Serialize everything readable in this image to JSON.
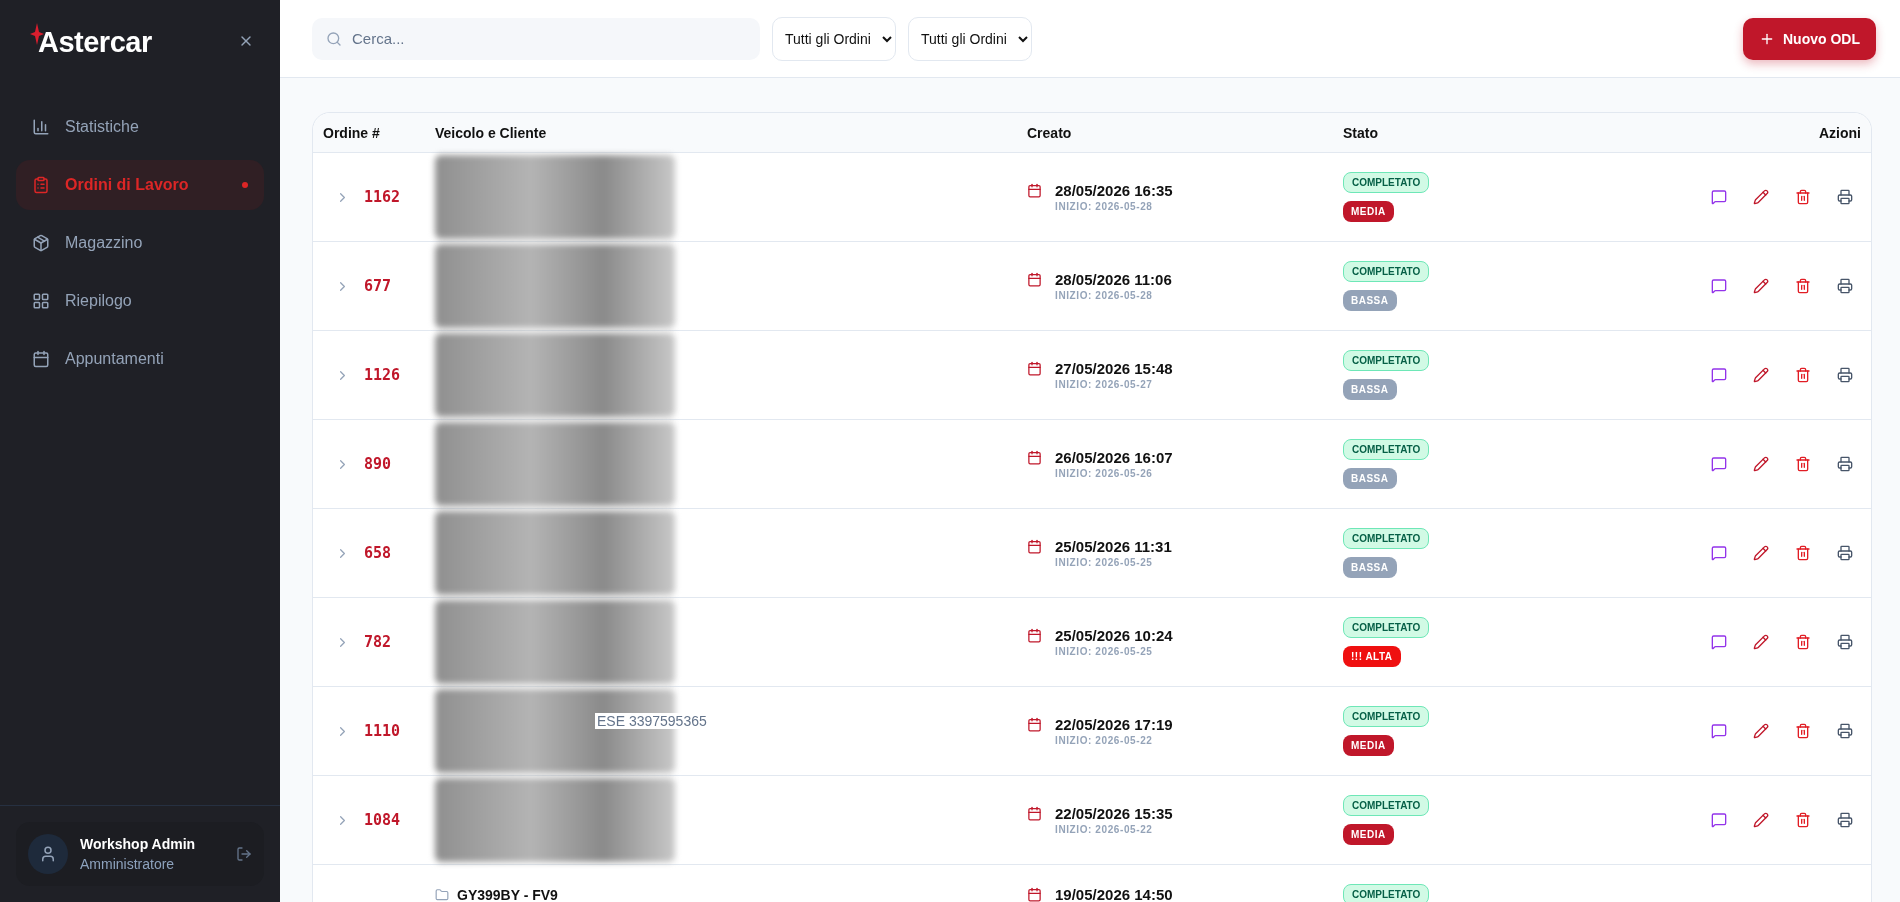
{
  "sidebar": {
    "brand": "Astercar",
    "items": [
      {
        "label": "Statistiche",
        "selected": false
      },
      {
        "label": "Ordini di Lavoro",
        "selected": true
      },
      {
        "label": "Magazzino",
        "selected": false
      },
      {
        "label": "Riepilogo",
        "selected": false
      },
      {
        "label": "Appuntamenti",
        "selected": false
      }
    ],
    "user": {
      "name": "Workshop Admin",
      "role": "Amministratore"
    }
  },
  "toolbar": {
    "search": {
      "placeholder": "Cerca..."
    },
    "filters": [
      "Tutti gli Ordini",
      "Tutti gli Ordini"
    ],
    "new_button": "Nuovo ODL"
  },
  "table": {
    "columns": [
      "Ordine #",
      "Veicolo e Cliente",
      "Creato",
      "Stato",
      "Azioni"
    ],
    "rows": [
      {
        "order": "1162",
        "blurred": true,
        "created": "28/05/2026 16:35",
        "start": "INIZIO: 2026-05-28",
        "status": "COMPLETATO",
        "priority": {
          "label": "MEDIA",
          "kind": "media"
        }
      },
      {
        "order": "677",
        "blurred": true,
        "created": "28/05/2026 11:06",
        "start": "INIZIO: 2026-05-28",
        "status": "COMPLETATO",
        "priority": {
          "label": "BASSA",
          "kind": "bassa"
        }
      },
      {
        "order": "1126",
        "blurred": true,
        "created": "27/05/2026 15:48",
        "start": "INIZIO: 2026-05-27",
        "status": "COMPLETATO",
        "priority": {
          "label": "BASSA",
          "kind": "bassa"
        }
      },
      {
        "order": "890",
        "blurred": true,
        "created": "26/05/2026 16:07",
        "start": "INIZIO: 2026-05-26",
        "status": "COMPLETATO",
        "priority": {
          "label": "BASSA",
          "kind": "bassa"
        }
      },
      {
        "order": "658",
        "blurred": true,
        "created": "25/05/2026 11:31",
        "start": "INIZIO: 2026-05-25",
        "status": "COMPLETATO",
        "priority": {
          "label": "BASSA",
          "kind": "bassa"
        }
      },
      {
        "order": "782",
        "blurred": true,
        "created": "25/05/2026 10:24",
        "start": "INIZIO: 2026-05-25",
        "status": "COMPLETATO",
        "priority": {
          "label": "!!! ALTA",
          "kind": "alta"
        }
      },
      {
        "order": "1110",
        "blurred": true,
        "visible_text": "ESE 3397595365",
        "created": "22/05/2026 17:19",
        "start": "INIZIO: 2026-05-22",
        "status": "COMPLETATO",
        "priority": {
          "label": "MEDIA",
          "kind": "media"
        }
      },
      {
        "order": "1084",
        "blurred": true,
        "created": "22/05/2026 15:35",
        "start": "INIZIO: 2026-05-22",
        "status": "COMPLETATO",
        "priority": {
          "label": "MEDIA",
          "kind": "media"
        }
      },
      {
        "blurred": false,
        "vehicle": "GY399BY - FV9",
        "created": "19/05/2026 14:50",
        "status": "COMPLETATO"
      }
    ]
  }
}
